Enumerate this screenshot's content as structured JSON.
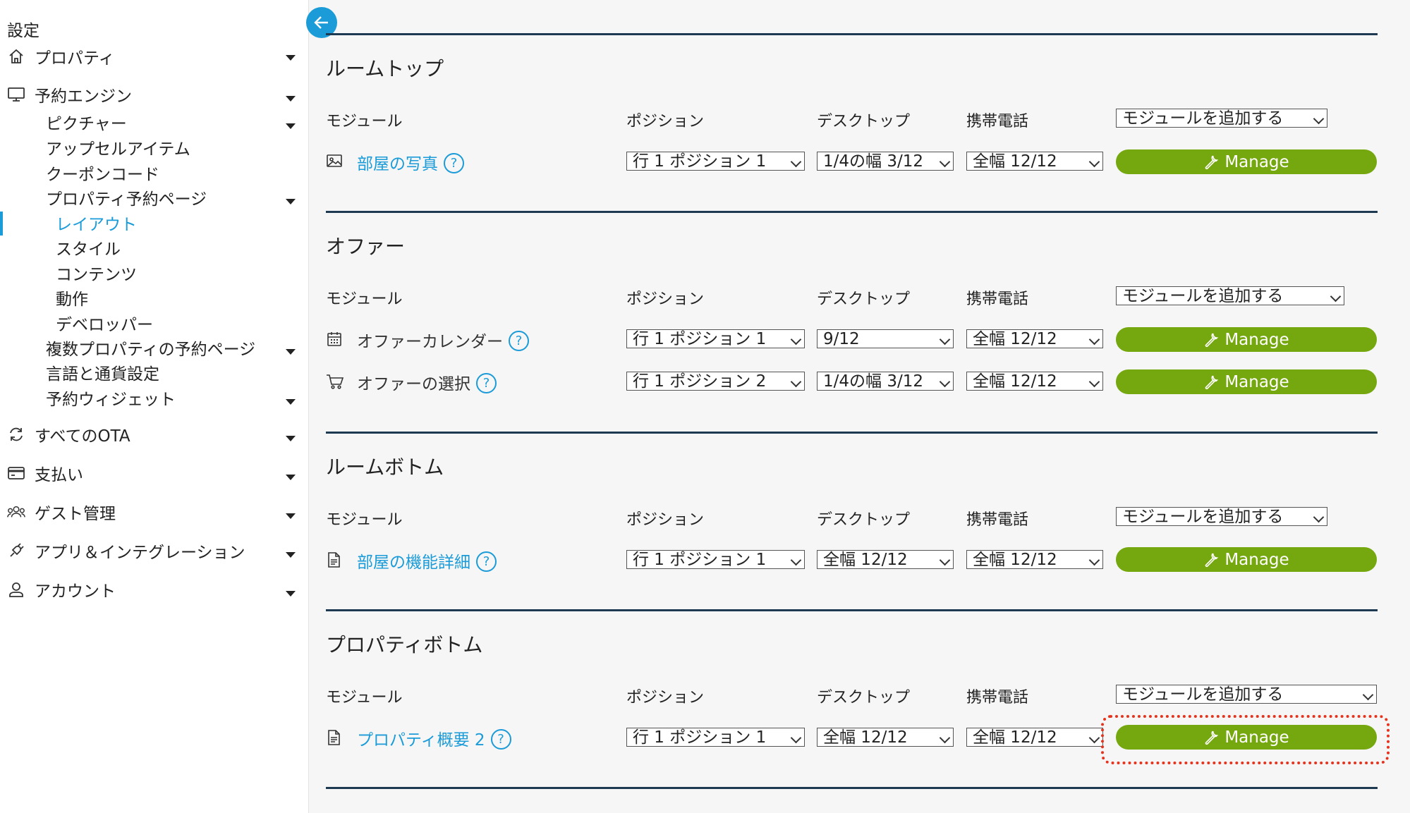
{
  "sidebar": {
    "title": "設定",
    "items": [
      {
        "label": "プロパティ",
        "icon": "home-icon"
      },
      {
        "label": "予約エンジン",
        "icon": "monitor-icon"
      },
      {
        "label": "ピクチャー"
      },
      {
        "label": "アップセルアイテム"
      },
      {
        "label": "クーポンコード"
      },
      {
        "label": "プロパティ予約ページ"
      },
      {
        "label": "レイアウト",
        "active": true
      },
      {
        "label": "スタイル"
      },
      {
        "label": "コンテンツ"
      },
      {
        "label": "動作"
      },
      {
        "label": "デベロッパー"
      },
      {
        "label": "複数プロパティの予約ページ"
      },
      {
        "label": "言語と通貨設定"
      },
      {
        "label": "予約ウィジェット"
      },
      {
        "label": "すべてのOTA",
        "icon": "sync-icon"
      },
      {
        "label": "支払い",
        "icon": "credit-card-icon"
      },
      {
        "label": "ゲスト管理",
        "icon": "guests-icon"
      },
      {
        "label": "アプリ＆インテグレーション",
        "icon": "plug-icon"
      },
      {
        "label": "アカウント",
        "icon": "user-icon"
      }
    ]
  },
  "headers": {
    "module": "モジュール",
    "position": "ポジション",
    "desktop": "デスクトップ",
    "mobile": "携帯電話"
  },
  "add_module_label": "モジュールを追加する",
  "manage_label": "Manage",
  "help_glyph": "?",
  "sections": [
    {
      "title": "ルームトップ",
      "modules": [
        {
          "name": "部屋の写真",
          "icon": "image-icon",
          "position": "行 1 ポジション 1",
          "desktop": "1/4の幅 3/12",
          "mobile": "全幅 12/12"
        }
      ]
    },
    {
      "title": "オファー",
      "modules": [
        {
          "name": "オファーカレンダー",
          "icon": "calendar-icon",
          "position": "行 1 ポジション 1",
          "desktop": "9/12",
          "mobile": "全幅 12/12"
        },
        {
          "name": "オファーの選択",
          "icon": "cart-icon",
          "position": "行 1 ポジション 2",
          "desktop": "1/4の幅 3/12",
          "mobile": "全幅 12/12"
        }
      ]
    },
    {
      "title": "ルームボトム",
      "modules": [
        {
          "name": "部屋の機能詳細",
          "icon": "document-icon",
          "position": "行 1 ポジション 1",
          "desktop": "全幅 12/12",
          "mobile": "全幅 12/12"
        }
      ]
    },
    {
      "title": "プロパティボトム",
      "modules": [
        {
          "name": "プロパティ概要 2",
          "icon": "document-icon",
          "position": "行 1 ポジション 1",
          "desktop": "全幅 12/12",
          "mobile": "全幅 12/12"
        }
      ]
    }
  ],
  "colors": {
    "accent": "#1b9bd8",
    "manage_green": "#74a80e",
    "rule": "#1d3a52",
    "highlight": "#e8321c"
  }
}
